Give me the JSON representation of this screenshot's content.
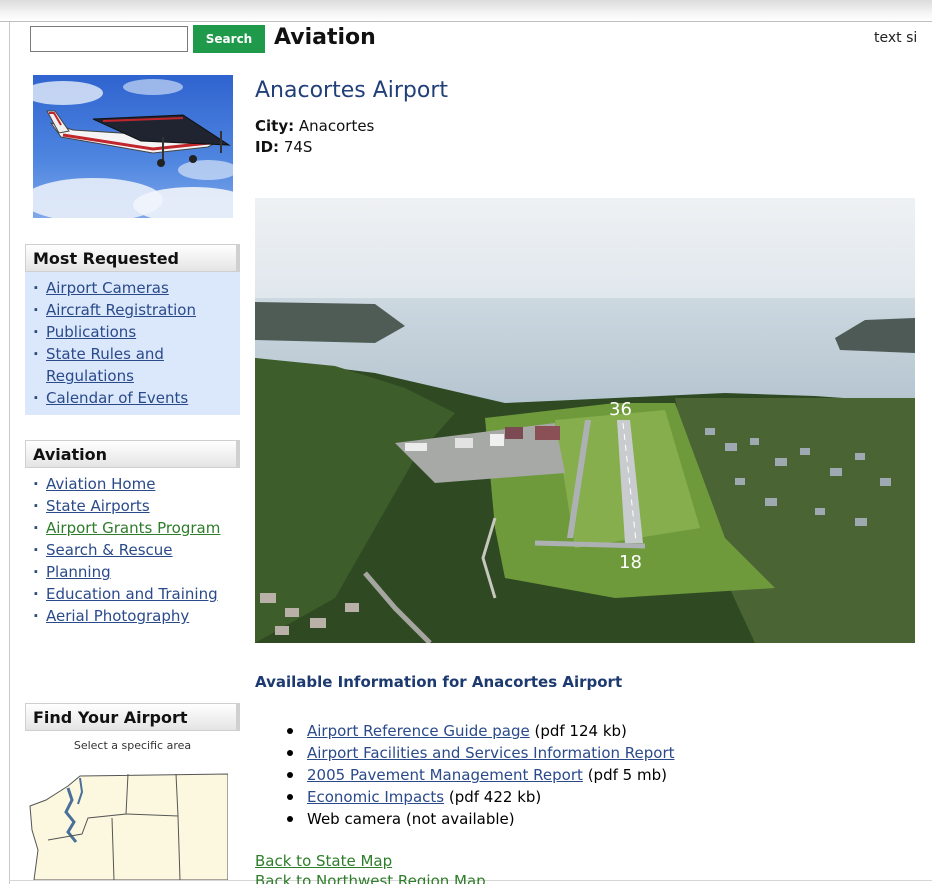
{
  "header": {
    "search_placeholder": "",
    "search_button": "Search",
    "site_title": "Aviation",
    "text_size_label": "text si"
  },
  "sidebar": {
    "most_requested": {
      "title": "Most Requested",
      "items": [
        "Airport Cameras",
        "Aircraft Registration",
        "Publications",
        "State Rules and Regulations",
        "Calendar of Events"
      ]
    },
    "aviation": {
      "title": "Aviation",
      "items": [
        "Aviation Home",
        "State Airports",
        "Airport Grants Program",
        "Search & Rescue",
        "Planning",
        "Education and Training",
        "Aerial Photography"
      ]
    },
    "find_airport": {
      "title": "Find Your Airport",
      "note": "Select a specific area"
    }
  },
  "main": {
    "airport_name": "Anacortes Airport",
    "city_label": "City:",
    "city_value": "Anacortes",
    "id_label": "ID:",
    "id_value": "74S",
    "runway_labels": [
      "36",
      "18"
    ],
    "info_heading": "Available Information for Anacortes Airport",
    "info_items": [
      {
        "link": "Airport Reference Guide page",
        "note": "(pdf 124 kb)"
      },
      {
        "link": "Airport Facilities and Services Information Report",
        "note": ""
      },
      {
        "link": "2005 Pavement Management Report",
        "note": "(pdf 5 mb)"
      },
      {
        "link": "Economic Impacts",
        "note": "(pdf 422 kb)"
      },
      {
        "link": "",
        "note": "Web camera (not available)"
      }
    ],
    "back_links": [
      "Back to State Map",
      "Back to Northwest Region Map"
    ]
  },
  "colors": {
    "search_button": "#1f9a4a",
    "link_blue": "#2a4a8a",
    "link_green": "#2e7d2a",
    "heading_navy": "#213f78",
    "most_requested_bg": "#dbe8fb"
  }
}
